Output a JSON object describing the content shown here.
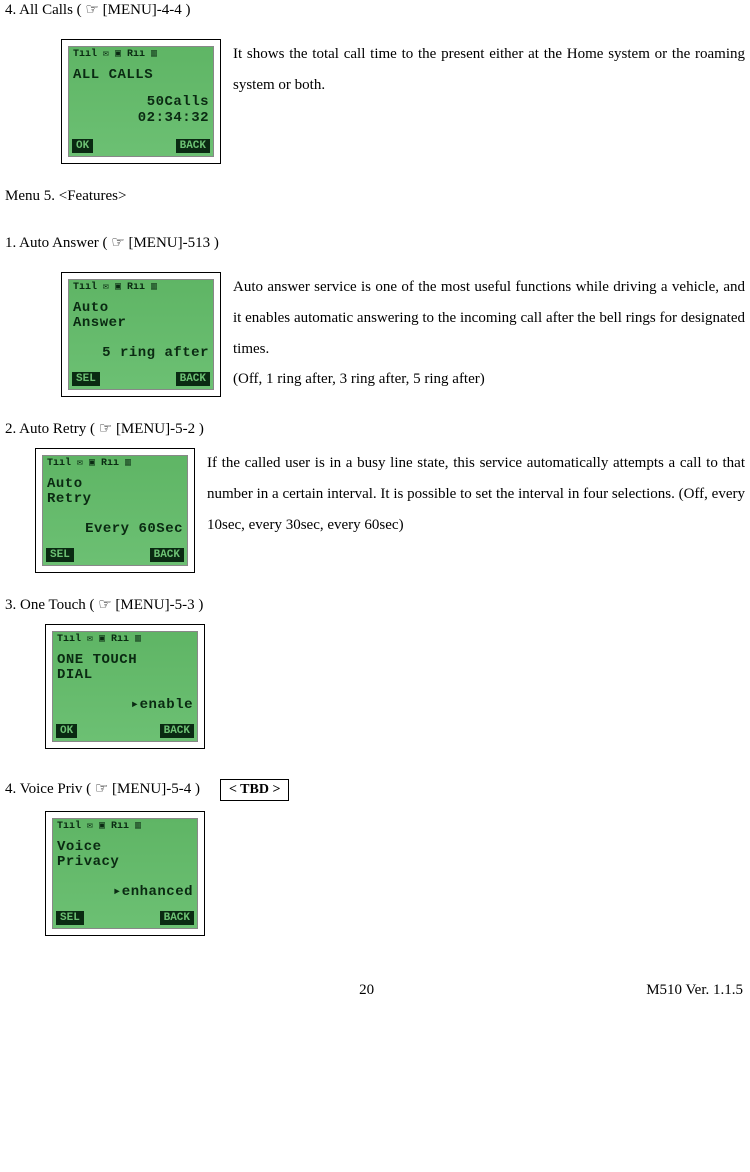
{
  "sections": {
    "allCalls": {
      "title": "4. All Calls ( ☞ [MENU]-4-4 )",
      "desc": "It shows the total call time to the present either at the Home system or the roaming system or both.",
      "lcd": {
        "status": "Tııl    ✉ ▣ Rıı ▥",
        "line1": "ALL CALLS",
        "line3": "50Calls",
        "line4": "02:34:32",
        "skLeft": "OK",
        "skRight": "BACK"
      }
    },
    "menu5": {
      "heading": "Menu 5. <Features>"
    },
    "autoAnswer": {
      "title": "1. Auto Answer ( ☞ [MENU]-513 )",
      "desc": "Auto answer service is one of the most useful functions while driving a vehicle, and it enables automatic answering to the incoming call after the bell rings for designated times.",
      "desc2": "(Off, 1 ring after, 3 ring after, 5 ring after)",
      "lcd": {
        "status": "Tııl    ✉ ▣ Rıı ▥",
        "line1": "Auto",
        "line2": "Answer",
        "value": "5 ring after",
        "skLeft": "SEL",
        "skRight": "BACK"
      }
    },
    "autoRetry": {
      "title": "2. Auto Retry ( ☞ [MENU]-5-2 )",
      "desc": "If the called user is in a busy line state, this service automatically attempts a call to that number in a certain interval. It is possible to set the interval in four selections. (Off, every 10sec, every 30sec, every 60sec)",
      "lcd": {
        "status": "Tııl    ✉ ▣ Rıı ▥",
        "line1": "Auto",
        "line2": "Retry",
        "value": "Every 60Sec",
        "skLeft": "SEL",
        "skRight": "BACK"
      }
    },
    "oneTouch": {
      "title": "3. One Touch ( ☞ [MENU]-5-3 )",
      "lcd": {
        "status": "Tııl    ✉ ▣ Rıı ▥",
        "line1": "ONE TOUCH",
        "line2": "DIAL",
        "value": "▸enable",
        "skLeft": "OK",
        "skRight": "BACK"
      }
    },
    "voicePriv": {
      "title": "4. Voice Priv ( ☞ [MENU]-5-4 )",
      "tbd": "< TBD >",
      "lcd": {
        "status": "Tııl    ✉ ▣ Rıı ▥",
        "line1": "Voice",
        "line2": "Privacy",
        "value": "▸enhanced",
        "skLeft": "SEL",
        "skRight": "BACK"
      }
    }
  },
  "footer": {
    "page": "20",
    "version": "M510   Ver. 1.1.5"
  }
}
